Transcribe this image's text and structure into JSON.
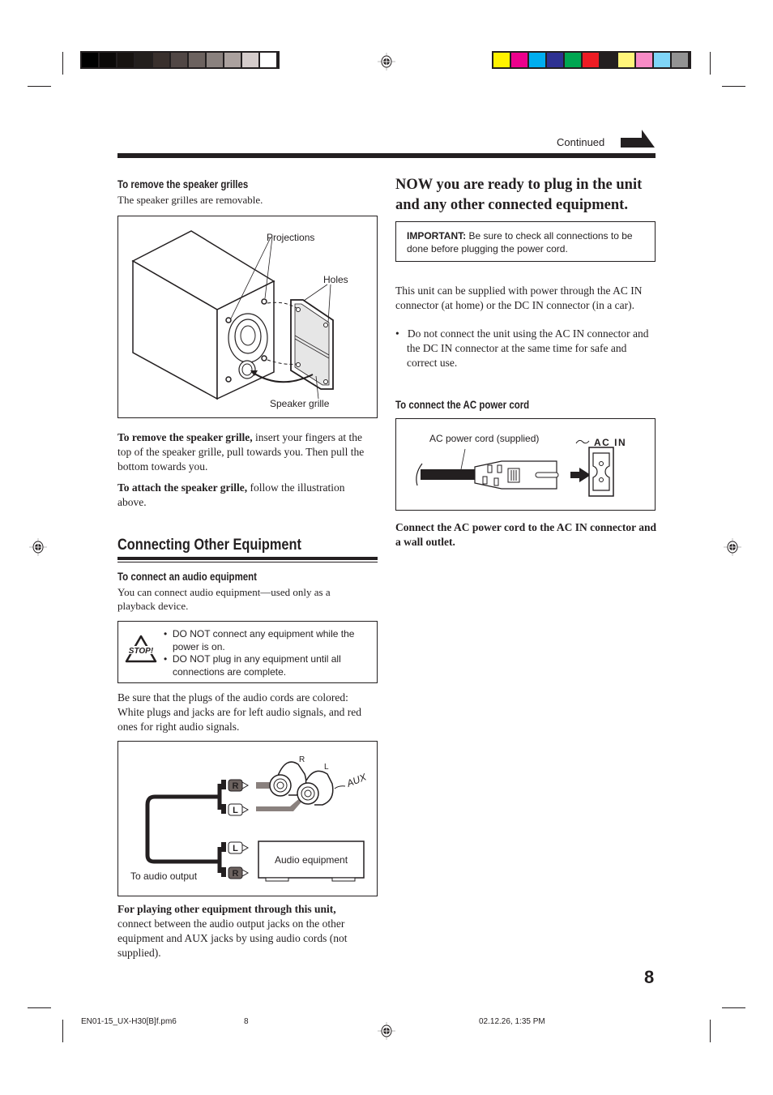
{
  "color_bars": {
    "grayscale": [
      "#000000",
      "#0b0908",
      "#171311",
      "#231f1d",
      "#39302d",
      "#514745",
      "#6c625f",
      "#8a817e",
      "#aba19e",
      "#d5cccb",
      "#ffffff"
    ],
    "process": [
      "#fff200",
      "#ec008c",
      "#00aeef",
      "#2e3192",
      "#00a651",
      "#ed1c24",
      "#231f20",
      "#fff57a",
      "#f78bc5",
      "#7fd5f7",
      "#939393"
    ]
  },
  "header": {
    "continued_label": "Continued"
  },
  "left": {
    "grilles": {
      "heading": "To remove the speaker grilles",
      "intro": "The speaker grilles are removable.",
      "figure_labels": {
        "projections": "Projections",
        "holes": "Holes",
        "speaker_grille": "Speaker grille"
      },
      "remove_bold": "To remove the speaker grille,",
      "remove_text": " insert your fingers at the top of the speaker grille, pull towards you. Then pull the bottom towards you.",
      "attach_bold": "To attach the speaker grille,",
      "attach_text": " follow the illustration above."
    },
    "section_title": "Connecting Other Equipment",
    "audio": {
      "heading": "To connect an audio equipment",
      "intro": "You can connect audio equipment—used only as a playback device.",
      "stop_icon_label": "STOP!",
      "warnings": [
        "DO NOT connect any equipment while the power is on.",
        "DO NOT plug in any equipment until all connections are complete."
      ],
      "plug_note": "Be sure that the plugs of the audio cords are colored: White plugs and jacks are for left audio signals, and red ones for right audio signals.",
      "figure_labels": {
        "jack_r": "R",
        "jack_l": "L",
        "aux": "AUX",
        "plug_r": "R",
        "plug_l": "L",
        "audio_equipment": "Audio equipment",
        "to_audio_output": "To audio output"
      },
      "playing_bold": "For playing other equipment through this unit,",
      "playing_text": " connect between the audio output jacks on the other equipment and AUX jacks by using audio cords (not supplied)."
    }
  },
  "right": {
    "title": "NOW you are ready to plug in the unit and any other connected equipment.",
    "important_bold": "IMPORTANT:",
    "important_text": " Be sure to check all connections to be done before plugging the power cord.",
    "power_text": "This unit can be supplied with power through the AC IN connector (at home) or the DC IN connector (in a car).",
    "power_bullet": "Do not connect the unit using the AC IN connector and the DC IN connector at the same time for safe and correct use.",
    "ac": {
      "heading": "To connect the AC power cord",
      "cord_label": "AC power cord (supplied)",
      "ac_in_label": "AC IN",
      "instruction": "Connect the AC power cord to the AC IN connector and a wall outlet."
    }
  },
  "page_number": "8",
  "footer": {
    "filename": "EN01-15_UX-H30[B]f.pm6",
    "page": "8",
    "timestamp": "02.12.26, 1:35 PM"
  }
}
